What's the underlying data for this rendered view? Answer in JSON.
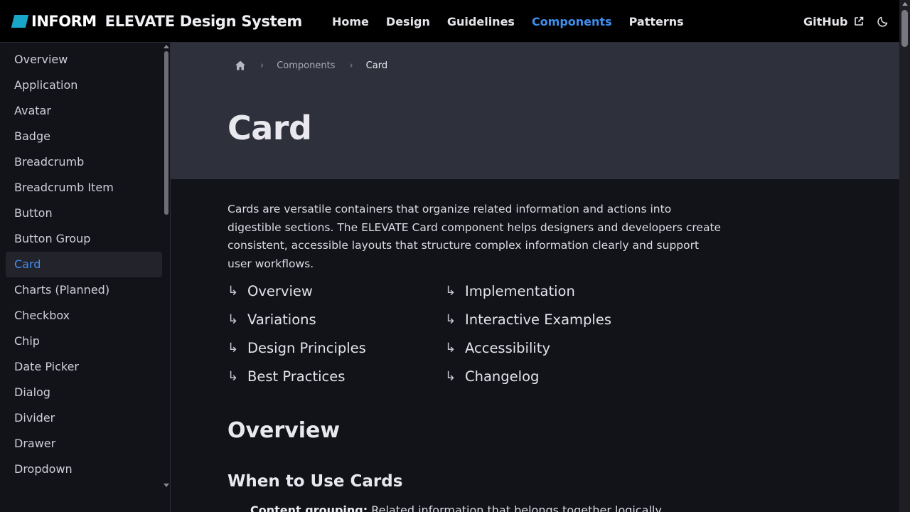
{
  "header": {
    "logo_text": "INFORM",
    "site_title": "ELEVATE Design System",
    "nav": [
      {
        "label": "Home"
      },
      {
        "label": "Design"
      },
      {
        "label": "Guidelines"
      },
      {
        "label": "Components"
      },
      {
        "label": "Patterns"
      }
    ],
    "active_nav": "Components",
    "github_label": "GitHub",
    "icons": {
      "external": "external-link-icon",
      "theme": "moon-icon"
    }
  },
  "sidebar": {
    "items": [
      {
        "label": "Overview"
      },
      {
        "label": "Application"
      },
      {
        "label": "Avatar"
      },
      {
        "label": "Badge"
      },
      {
        "label": "Breadcrumb"
      },
      {
        "label": "Breadcrumb Item"
      },
      {
        "label": "Button"
      },
      {
        "label": "Button Group"
      },
      {
        "label": "Card"
      },
      {
        "label": "Charts (Planned)"
      },
      {
        "label": "Checkbox"
      },
      {
        "label": "Chip"
      },
      {
        "label": "Date Picker"
      },
      {
        "label": "Dialog"
      },
      {
        "label": "Divider"
      },
      {
        "label": "Drawer"
      },
      {
        "label": "Dropdown"
      }
    ],
    "active_item": "Card"
  },
  "breadcrumb": {
    "home_icon": "home-icon",
    "items": [
      "Components",
      "Card"
    ]
  },
  "page": {
    "title": "Card",
    "intro": "Cards are versatile containers that organize related information and actions into digestible sections. The ELEVATE Card component helps designers and developers create consistent, accessible layouts that structure complex information clearly and support user workflows.",
    "toc_arrow": "↳",
    "toc": [
      {
        "label": "Overview"
      },
      {
        "label": "Variations"
      },
      {
        "label": "Design Principles"
      },
      {
        "label": "Best Practices"
      },
      {
        "label": "Implementation"
      },
      {
        "label": "Interactive Examples"
      },
      {
        "label": "Accessibility"
      },
      {
        "label": "Changelog"
      }
    ],
    "overview_heading": "Overview",
    "when_heading": "When to Use Cards",
    "first_bullet": {
      "term": "Content grouping:",
      "text": " Related information that belongs together logically"
    }
  },
  "colors": {
    "accent": "#3f8ff0",
    "logo": "#18a6c9",
    "header_bg": "#000000",
    "hero_bg": "#2e303c",
    "content_bg": "#121219"
  }
}
